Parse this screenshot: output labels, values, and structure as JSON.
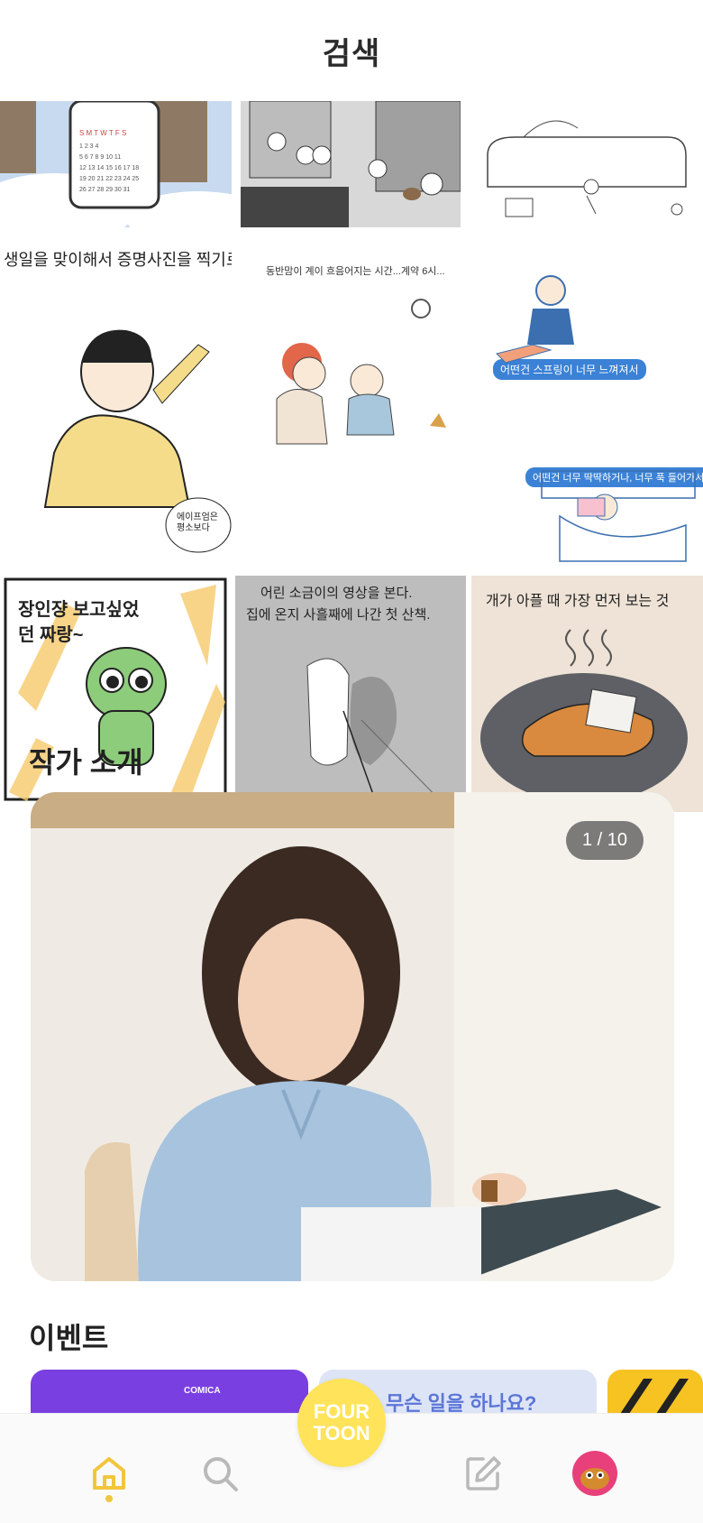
{
  "header": {
    "title": "검색"
  },
  "grid": {
    "tiles": [
      {
        "name": "calendar-comic",
        "caption": ""
      },
      {
        "name": "city-people-comic",
        "caption": ""
      },
      {
        "name": "sofa-sketch-comic",
        "caption": ""
      },
      {
        "name": "id-photo-comic",
        "caption": "생일을 맞이해서 증명사진을 찍기로 했다."
      },
      {
        "name": "baby-comic",
        "caption": "동반맘이 계이 흐음어지는 시간...계약 6시..."
      },
      {
        "name": "spring-comic",
        "caption_top": "어떤건 스프링이 너무 느껴져서",
        "caption_bottom": "어떤건 너무 딱딱하거나, 너무 푹 들어가서"
      },
      {
        "name": "dino-comic",
        "caption": "장인쟝 보고싶었던 짜랑~"
      },
      {
        "name": "dog-walk-comic",
        "caption_line1": "어린 소금이의 영상을 본다.",
        "caption_line2": "집에 온지 사흘째에 나간 첫 산책."
      },
      {
        "name": "sick-dog-comic",
        "caption": "개가 아플 때 가장 먼저 보는 것"
      }
    ]
  },
  "author_section": {
    "title": "작가 소개",
    "counter": "1 / 10"
  },
  "events_section": {
    "title": "이벤트",
    "card2_text": "무슨 일을 하나요?",
    "card1_brand": "COMICA"
  },
  "fab": {
    "line1": "FOUR",
    "line2": "TOON"
  },
  "colors": {
    "accent": "#ffe35a",
    "nav_active": "#f2c53d",
    "nav_inactive": "#b9b9b9"
  },
  "nav": {
    "items": [
      "home-icon",
      "search-icon",
      "edit-icon",
      "profile-avatar"
    ]
  }
}
